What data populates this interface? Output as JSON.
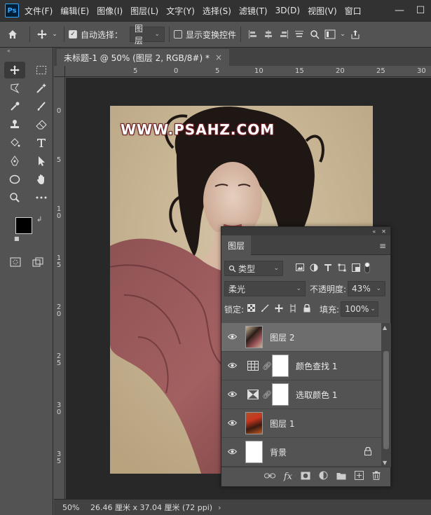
{
  "app": {
    "logo_text": "Ps",
    "menu": [
      "文件(F)",
      "编辑(E)",
      "图像(I)",
      "图层(L)",
      "文字(Y)",
      "选择(S)",
      "滤镜(T)",
      "3D(D)",
      "视图(V)",
      "窗口"
    ],
    "window_buttons": {
      "minimize": "—",
      "maximize": "☐"
    }
  },
  "options_bar": {
    "auto_select_label": "自动选择：",
    "auto_select_checked": true,
    "auto_select_target": "图层",
    "show_transform_label": "显示变换控件",
    "show_transform_checked": false
  },
  "document": {
    "tab_title": "未标题-1 @ 50% (图层 2, RGB/8#) *",
    "close": "×",
    "watermark": "WWW.PSAHZ.COM"
  },
  "rulers": {
    "h_labels": [
      "5",
      "0",
      "5",
      "10",
      "15",
      "20",
      "25",
      "30"
    ],
    "v_labels": [
      "0",
      "5",
      "10",
      "15",
      "20",
      "25",
      "30",
      "35"
    ]
  },
  "status": {
    "zoom": "50%",
    "info": "26.46 厘米 x 37.04 厘米 (72 ppi)",
    "arrow": "›"
  },
  "layers_panel": {
    "tab": "图层",
    "filter_kind": "类型",
    "blend_mode": "柔光",
    "opacity_label": "不透明度:",
    "opacity": "43%",
    "lock_label": "锁定:",
    "fill_label": "填充:",
    "fill": "100%",
    "layers": [
      {
        "name": "图层 2",
        "type": "pixel",
        "selected": true
      },
      {
        "name": "颜色查找 1",
        "type": "adjustment-lookup",
        "selected": false
      },
      {
        "name": "选取颜色 1",
        "type": "adjustment-selective",
        "selected": false
      },
      {
        "name": "图层 1",
        "type": "pixel",
        "selected": false
      },
      {
        "name": "背景",
        "type": "background",
        "selected": false
      }
    ]
  },
  "colors": {
    "foreground": "#000000",
    "background": "#ffffff",
    "accent": "#31a8ff"
  }
}
